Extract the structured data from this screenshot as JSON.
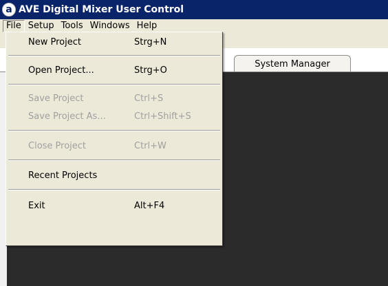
{
  "window": {
    "title": "AVE Digital Mixer User Control",
    "icon_glyph": "a"
  },
  "menubar": {
    "items": [
      {
        "label": "File",
        "active": true
      },
      {
        "label": "Setup"
      },
      {
        "label": "Tools"
      },
      {
        "label": "Windows"
      },
      {
        "label": "Help"
      }
    ]
  },
  "tabs": [
    {
      "label": "System Manager"
    }
  ],
  "file_menu": {
    "items": [
      {
        "label": "New Project",
        "shortcut": "Strg+N",
        "enabled": true
      },
      {
        "label": "Open Project...",
        "shortcut": "Strg+O",
        "enabled": true
      },
      {
        "label": "Save Project",
        "shortcut": "Ctrl+S",
        "enabled": false
      },
      {
        "label": "Save Project As...",
        "shortcut": "Ctrl+Shift+S",
        "enabled": false
      },
      {
        "label": "Close Project",
        "shortcut": "Ctrl+W",
        "enabled": false
      },
      {
        "label": "Recent Projects",
        "shortcut": "",
        "enabled": true
      },
      {
        "label": "Exit",
        "shortcut": "Alt+F4",
        "enabled": true
      }
    ]
  },
  "colors": {
    "titlebar": "#0a246a",
    "menu_bg": "#ece9d8",
    "workspace": "#2b2b2b",
    "disabled_text": "#a0a0a0"
  }
}
